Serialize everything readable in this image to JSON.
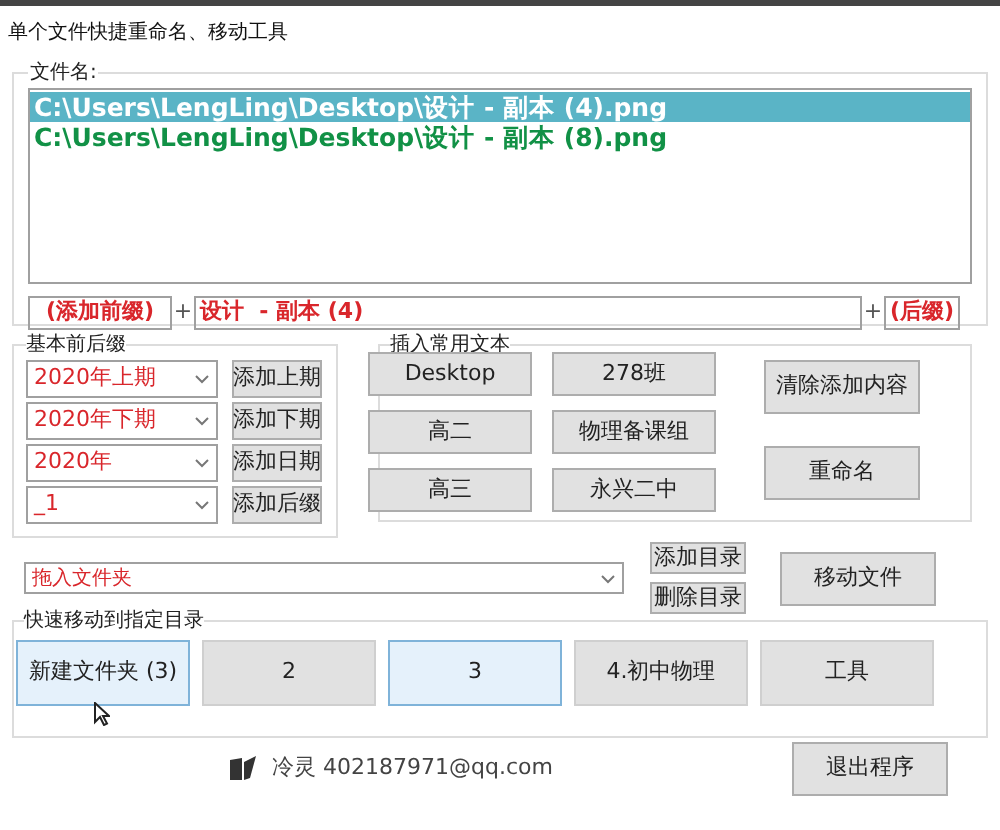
{
  "window": {
    "title": "单个文件快捷重命名、移动工具"
  },
  "files": {
    "label": "文件名:",
    "items": [
      {
        "path": "C:\\Users\\LengLing\\Desktop\\设计  - 副本 (4).png",
        "selected": true
      },
      {
        "path": "C:\\Users\\LengLing\\Desktop\\设计  - 副本 (8).png",
        "selected": false
      }
    ],
    "prefix": "(添加前缀)",
    "plus_1": "+",
    "name": "设计  - 副本 (4)",
    "plus_2": "+",
    "suffix": "(后缀)"
  },
  "basic": {
    "label": "基本前后缀",
    "rows": [
      {
        "value": "2020年上期",
        "button": "添加上期"
      },
      {
        "value": "2020年下期",
        "button": "添加下期"
      },
      {
        "value": "2020年",
        "button": "添加日期"
      },
      {
        "value": "_1",
        "button": "添加后缀"
      }
    ]
  },
  "common": {
    "label": "插入常用文本",
    "buttons": [
      "Desktop",
      "278班",
      "高二",
      "物理备课组",
      "高三",
      "永兴二中"
    ]
  },
  "actions": {
    "clear": "清除添加内容",
    "rename": "重命名"
  },
  "folder": {
    "placeholder": "拖入文件夹",
    "add": "添加目录",
    "remove": "删除目录",
    "move": "移动文件"
  },
  "quick": {
    "label": "快速移动到指定目录",
    "buttons": [
      {
        "label": "新建文件夹 (3)",
        "highlighted": true
      },
      {
        "label": "2",
        "highlighted": false
      },
      {
        "label": "3",
        "highlighted": true
      },
      {
        "label": "4.初中物理",
        "highlighted": false
      },
      {
        "label": "工具",
        "highlighted": false
      }
    ]
  },
  "footer": {
    "author": "冷灵 402187971@qq.com",
    "exit": "退出程序"
  }
}
